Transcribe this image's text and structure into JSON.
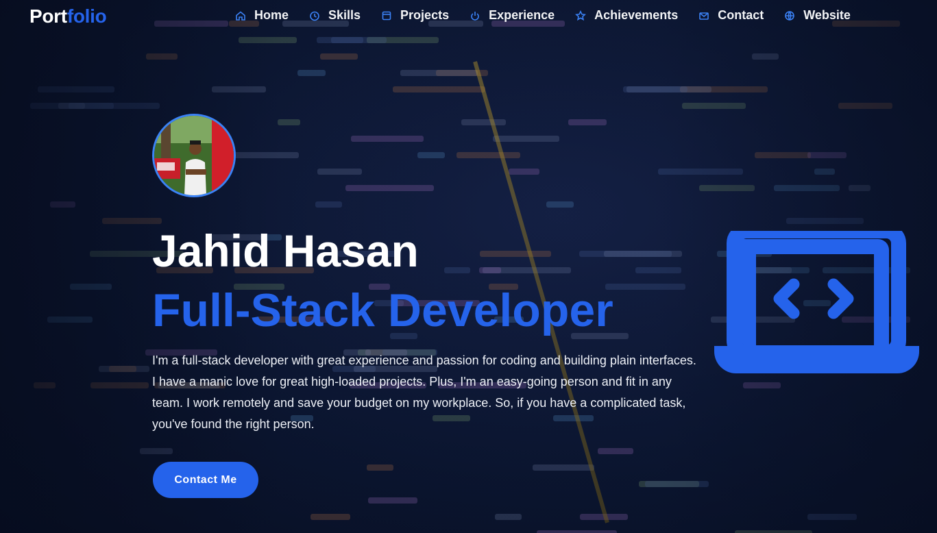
{
  "brand": {
    "part1": "Port",
    "part2": "folio"
  },
  "nav": [
    {
      "label": "Home",
      "icon": "home-icon"
    },
    {
      "label": "Skills",
      "icon": "clock-icon"
    },
    {
      "label": "Projects",
      "icon": "folder-icon"
    },
    {
      "label": "Experience",
      "icon": "power-icon"
    },
    {
      "label": "Achievements",
      "icon": "star-icon"
    },
    {
      "label": "Contact",
      "icon": "mail-icon"
    },
    {
      "label": "Website",
      "icon": "globe-icon"
    }
  ],
  "hero": {
    "name": "Jahid Hasan",
    "role": "Full-Stack Developer",
    "description": "I'm a full-stack developer with great experience and passion for coding and building plain interfaces. I have a manic love for great high-loaded projects. Plus, I'm an easy-going person and fit in any team. I work remotely and save your budget on my workplace. So, if you have a complicated task, you've found the right person.",
    "cta_label": "Contact Me"
  },
  "colors": {
    "accent": "#2563eb",
    "background": "#0c1733",
    "text": "#ffffff"
  }
}
